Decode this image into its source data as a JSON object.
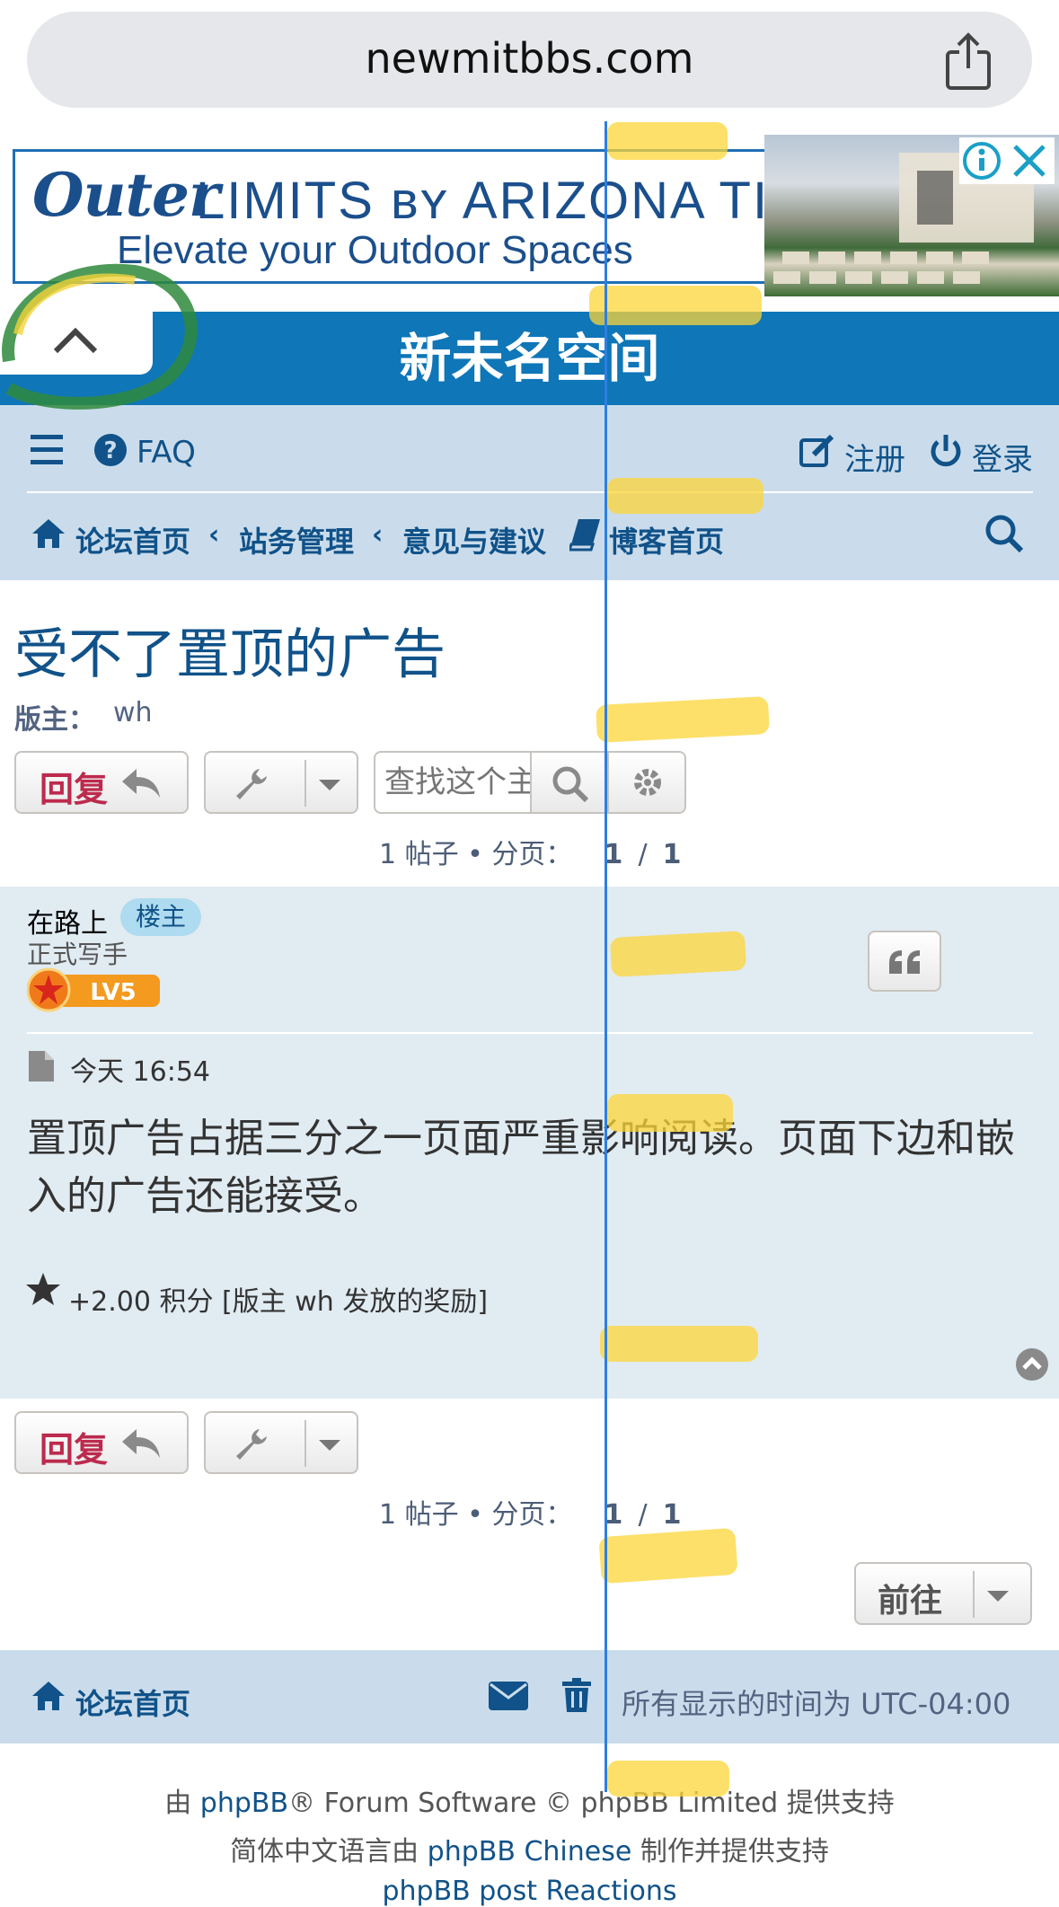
{
  "browser": {
    "url": "newmitbbs.com"
  },
  "ad": {
    "brand_script": "Outer",
    "brand_caps": "LIMITS ʙʏ ARIZONA TILE",
    "tagline": "Elevate your Outdoor Spaces"
  },
  "header": {
    "title": "新未名空间"
  },
  "nav": {
    "faq": "FAQ",
    "register": "注册",
    "login": "登录",
    "breadcrumbs": [
      "论坛首页",
      "站务管理",
      "意见与建议",
      "博客首页"
    ]
  },
  "topic": {
    "title": "受不了置顶的广告",
    "moderator_label": "版主：",
    "moderator": "wh",
    "reply_label": "回复",
    "search_placeholder": "查找这个主题…",
    "pagination": {
      "prefix": "1 帖子 • 分页：",
      "current": "1",
      "sep": "/",
      "total": "1"
    }
  },
  "post": {
    "author": "在路上",
    "author_badge": "楼主",
    "rank": "正式写手",
    "level_badge": "LV5",
    "time": "今天 16:54",
    "body": "置顶广告占据三分之一页面严重影响阅读。页面下边和嵌入的广告还能接受。",
    "reward": "+2.00 积分 [版主 wh 发放的奖励]"
  },
  "jump": {
    "label": "前往"
  },
  "footer": {
    "home": "论坛首页",
    "timezone": "所有显示的时间为 UTC-04:00",
    "credit1_pre": "由 ",
    "credit1_link": "phpBB",
    "credit1_post": "® Forum Software © phpBB Limited 提供支持",
    "credit2_pre": "简体中文语言由 ",
    "credit2_link": "phpBB Chinese",
    "credit2_post": " 制作并提供支持",
    "credit3": "phpBB post Reactions"
  },
  "colors": {
    "header": "#0f76b8",
    "nav_bg": "#cadceb",
    "post_bg": "#e1ebf2",
    "link": "#105289",
    "reply": "#bc2a4d"
  }
}
